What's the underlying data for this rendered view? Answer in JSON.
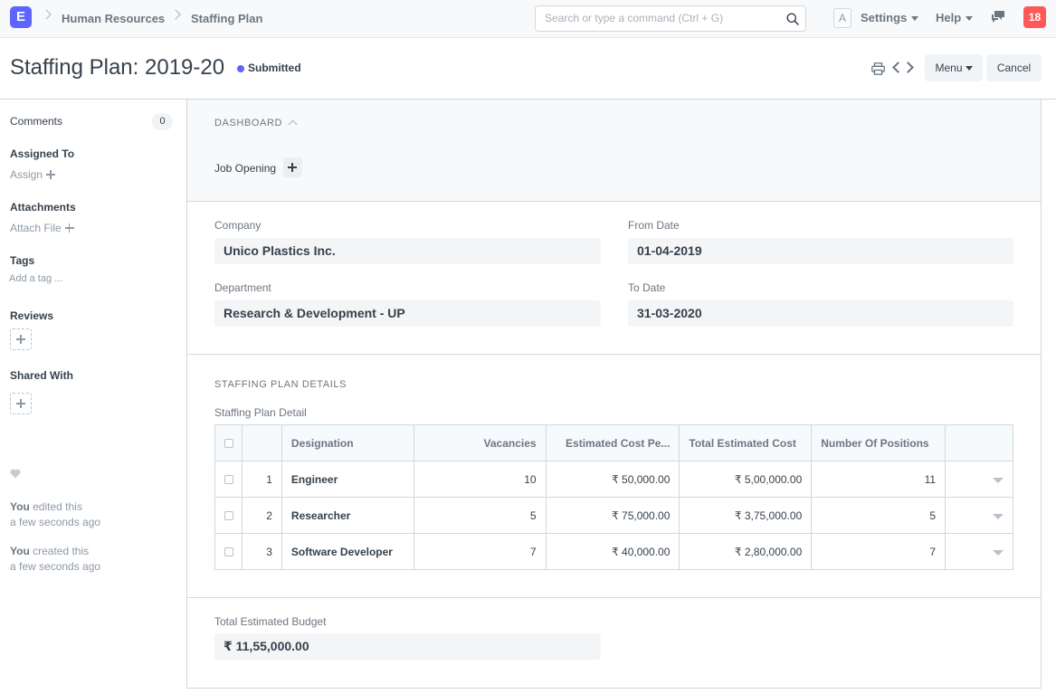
{
  "navbar": {
    "logo": "E",
    "breadcrumbs": [
      "Human Resources",
      "Staffing Plan"
    ],
    "search_placeholder": "Search or type a command (Ctrl + G)",
    "avatar_letter": "A",
    "settings": "Settings",
    "help": "Help",
    "notification_count": "18"
  },
  "header": {
    "title": "Staffing Plan: 2019-20",
    "status": "Submitted",
    "menu": "Menu",
    "cancel": "Cancel"
  },
  "sidebar": {
    "comments": "Comments",
    "comments_count": "0",
    "assigned_to": "Assigned To",
    "assign": "Assign",
    "attachments": "Attachments",
    "attach_file": "Attach File",
    "tags": "Tags",
    "add_tag": "Add a tag ...",
    "reviews": "Reviews",
    "shared_with": "Shared With",
    "activity": [
      {
        "user": "You",
        "action": " edited this",
        "time": "a few seconds ago"
      },
      {
        "user": "You",
        "action": " created this",
        "time": "a few seconds ago"
      }
    ]
  },
  "dashboard": {
    "heading": "DASHBOARD",
    "job_opening": "Job Opening"
  },
  "form": {
    "company_label": "Company",
    "company": "Unico Plastics Inc.",
    "from_date_label": "From Date",
    "from_date": "01-04-2019",
    "department_label": "Department",
    "department": "Research & Development - UP",
    "to_date_label": "To Date",
    "to_date": "31-03-2020"
  },
  "details": {
    "heading": "STAFFING PLAN DETAILS",
    "table_label": "Staffing Plan Detail",
    "columns": [
      "Designation",
      "Vacancies",
      "Estimated Cost Pe...",
      "Total Estimated Cost",
      "Number Of Positions"
    ],
    "rows": [
      {
        "idx": "1",
        "designation": "Engineer",
        "vacancies": "10",
        "est_cost": "₹ 50,000.00",
        "total_cost": "₹ 5,00,000.00",
        "positions": "11"
      },
      {
        "idx": "2",
        "designation": "Researcher",
        "vacancies": "5",
        "est_cost": "₹ 75,000.00",
        "total_cost": "₹ 3,75,000.00",
        "positions": "5"
      },
      {
        "idx": "3",
        "designation": "Software Developer",
        "vacancies": "7",
        "est_cost": "₹ 40,000.00",
        "total_cost": "₹ 2,80,000.00",
        "positions": "7"
      }
    ]
  },
  "budget": {
    "label": "Total Estimated Budget",
    "value": "₹ 11,55,000.00"
  }
}
